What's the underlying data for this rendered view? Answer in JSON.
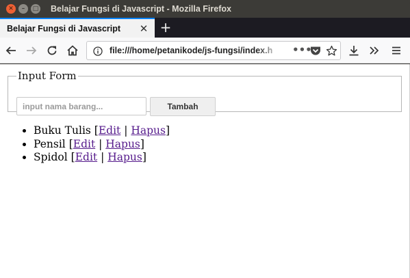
{
  "window": {
    "title": "Belajar Fungsi di Javascript - Mozilla Firefox"
  },
  "tabs": [
    {
      "label": "Belajar Fungsi di Javascript",
      "active": true
    }
  ],
  "navbar": {
    "url": "file:///home/petanikode/js-fungsi/index.h"
  },
  "form": {
    "legend": "Input Form",
    "input_placeholder": "input nama barang...",
    "input_value": "",
    "button_label": "Tambah"
  },
  "items": [
    {
      "name": "Buku Tulis",
      "edit": "Edit",
      "delete": "Hapus"
    },
    {
      "name": "Pensil",
      "edit": "Edit",
      "delete": "Hapus"
    },
    {
      "name": "Spidol",
      "edit": "Edit",
      "delete": "Hapus"
    }
  ],
  "colors": {
    "accent": "#0a84ff",
    "visited_link": "#551a8b",
    "titlebar": "#3c3b37",
    "close_button": "#ed6034"
  }
}
